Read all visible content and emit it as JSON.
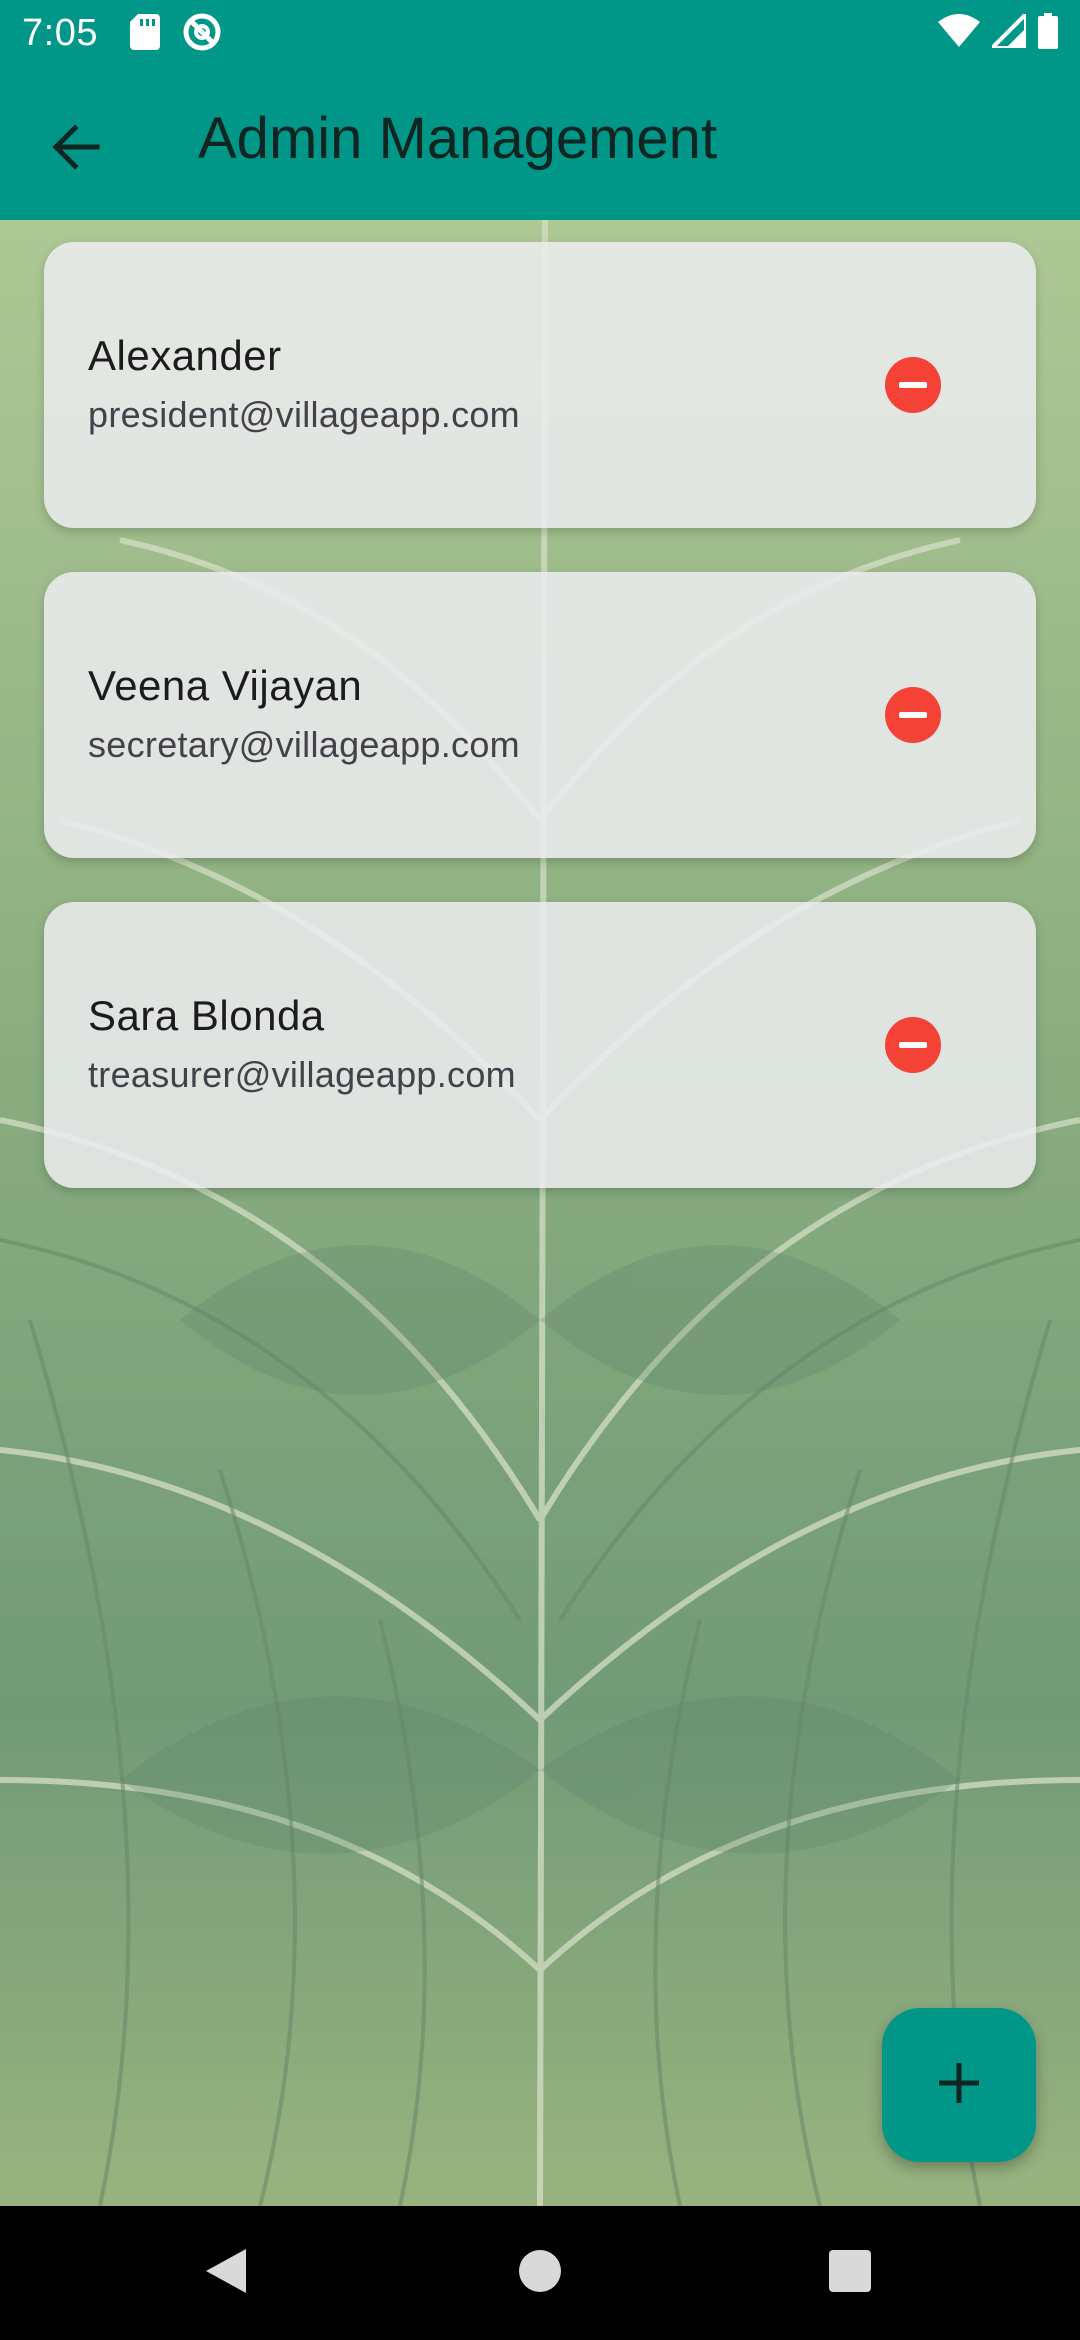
{
  "status_bar": {
    "time": "7:05",
    "left_icons": [
      "sd-card-icon",
      "no-sync-icon"
    ],
    "right_icons": [
      "wifi-icon",
      "cell-signal-icon",
      "battery-icon"
    ]
  },
  "app_bar": {
    "title": "Admin Management",
    "back_icon": "arrow-back-icon",
    "color": "#009688"
  },
  "admins": [
    {
      "name": "Alexander",
      "email": "president@villageapp.com",
      "action_icon": "remove-circle-icon"
    },
    {
      "name": "Veena Vijayan",
      "email": "secretary@villageapp.com",
      "action_icon": "remove-circle-icon"
    },
    {
      "name": "Sara Blonda",
      "email": "treasurer@villageapp.com",
      "action_icon": "remove-circle-icon"
    }
  ],
  "fab": {
    "icon": "add-icon"
  },
  "nav_bar": {
    "buttons": [
      "nav-back-icon",
      "nav-home-icon",
      "nav-recents-icon"
    ]
  },
  "colors": {
    "primary": "#009688",
    "danger": "#f44336",
    "card": "#ececf0",
    "title_text": "#0e2522"
  }
}
